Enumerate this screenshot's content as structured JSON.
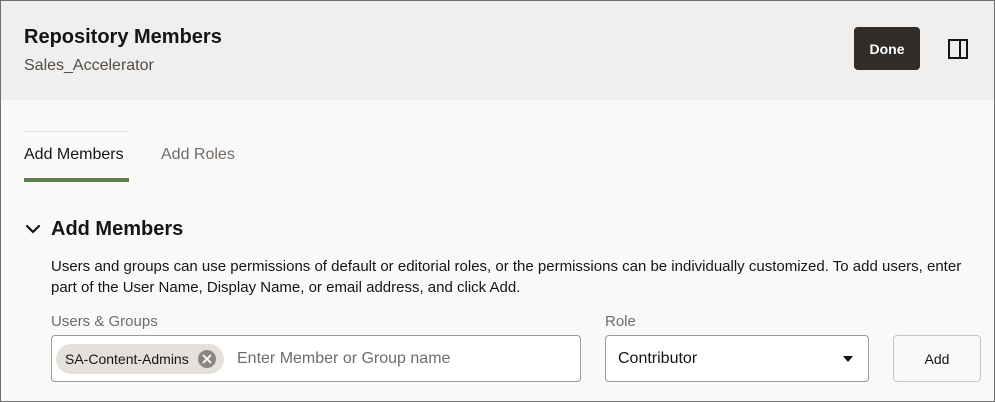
{
  "header": {
    "title": "Repository Members",
    "subtitle": "Sales_Accelerator",
    "done_label": "Done",
    "panel_icon": "panel-toggle-icon"
  },
  "tabs": [
    {
      "label": "Add Members",
      "selected": true
    },
    {
      "label": "Add Roles",
      "selected": false
    }
  ],
  "section": {
    "title": "Add Members",
    "description": "Users and groups can use permissions of default or editorial roles, or the permissions can be individually customized. To add users, enter part of the User Name, Display Name, or email address, and click Add."
  },
  "form": {
    "users_label": "Users & Groups",
    "chips": [
      {
        "label": "SA-Content-Admins"
      }
    ],
    "member_placeholder": "Enter Member or Group name",
    "member_value": "",
    "role_label": "Role",
    "role_value": "Contributor",
    "add_label": "Add"
  },
  "colors": {
    "accent": "#5f7d4f",
    "primary_button": "#312d2a",
    "header_bg": "#f1efed"
  }
}
